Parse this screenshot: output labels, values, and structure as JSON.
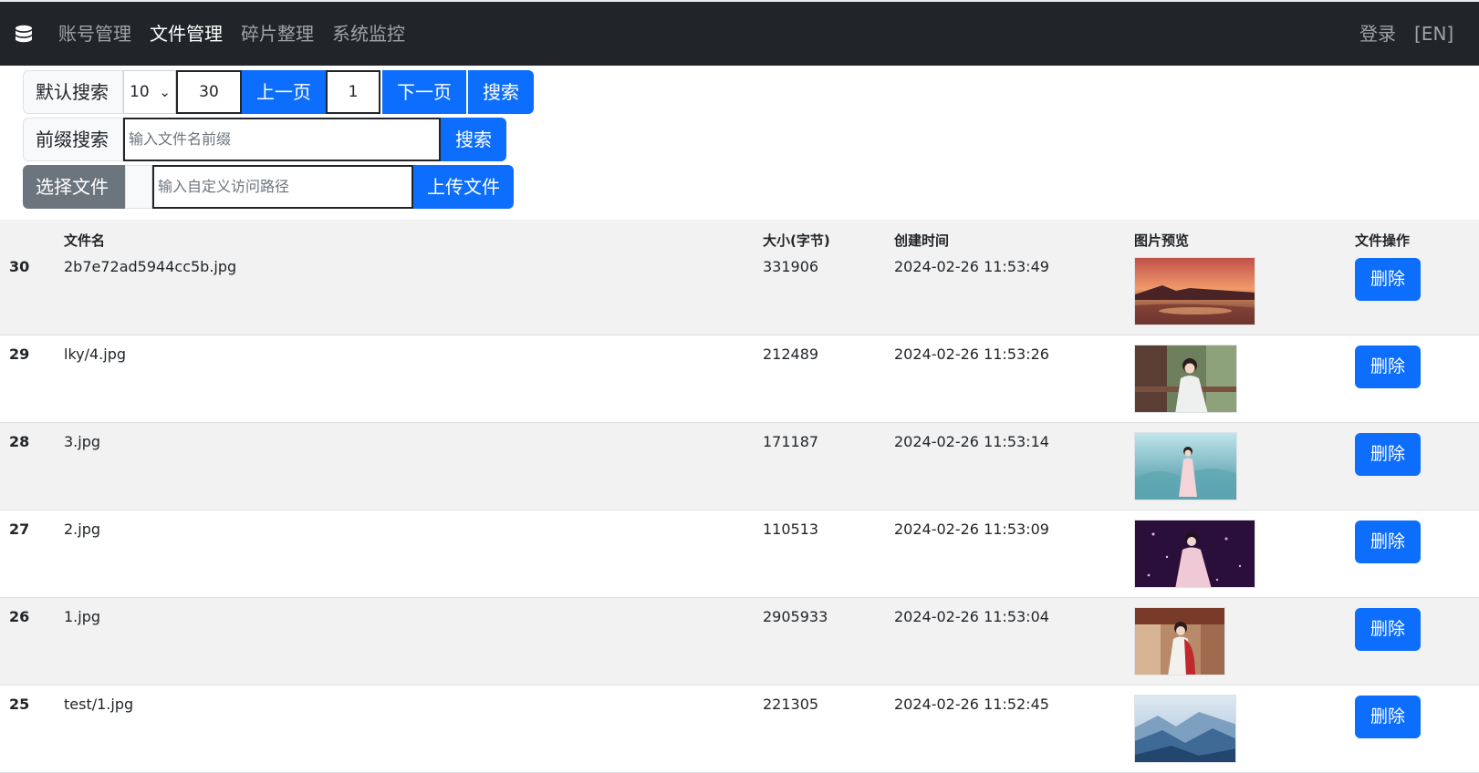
{
  "nav": {
    "items": [
      {
        "label": "账号管理",
        "active": false
      },
      {
        "label": "文件管理",
        "active": true
      },
      {
        "label": "碎片整理",
        "active": false
      },
      {
        "label": "系统监控",
        "active": false
      }
    ],
    "login_label": "登录",
    "lang_label": "[EN]"
  },
  "default_search": {
    "label": "默认搜索",
    "page_size": "10",
    "start_value": "30",
    "prev_label": "上一页",
    "page_value": "1",
    "next_label": "下一页",
    "search_label": "搜索"
  },
  "prefix_search": {
    "label": "前缀搜索",
    "placeholder": "输入文件名前缀",
    "search_label": "搜索"
  },
  "upload": {
    "choose_label": "选择文件",
    "path_placeholder": "输入自定义访问路径",
    "upload_label": "上传文件"
  },
  "table": {
    "headers": {
      "name": "文件名",
      "size": "大小(字节)",
      "time": "创建时间",
      "preview": "图片预览",
      "action": "文件操作"
    },
    "rows": [
      {
        "id": "30",
        "name": "2b7e72ad5944cc5b.jpg",
        "size": "331906",
        "time": "2024-02-26 11:53:49",
        "delete_label": "删除",
        "preview": "sunset-beach-image"
      },
      {
        "id": "29",
        "name": "lky/4.jpg",
        "size": "212489",
        "time": "2024-02-26 11:53:26",
        "delete_label": "删除",
        "preview": "woman-in-white-dress-image"
      },
      {
        "id": "28",
        "name": "3.jpg",
        "size": "171187",
        "time": "2024-02-26 11:53:14",
        "delete_label": "删除",
        "preview": "singer-misty-stage-image"
      },
      {
        "id": "27",
        "name": "2.jpg",
        "size": "110513",
        "time": "2024-02-26 11:53:09",
        "delete_label": "删除",
        "preview": "singer-purple-stage-image"
      },
      {
        "id": "26",
        "name": "1.jpg",
        "size": "2905933",
        "time": "2024-02-26 11:53:04",
        "delete_label": "删除",
        "preview": "woman-red-shawl-image"
      },
      {
        "id": "25",
        "name": "test/1.jpg",
        "size": "221305",
        "time": "2024-02-26 11:52:45",
        "delete_label": "删除",
        "preview": "mountain-valley-image"
      }
    ]
  },
  "colors": {
    "navbar": "#212529",
    "primary": "#0d6efd",
    "secondary": "#6c757d",
    "stripe": "#f2f2f2"
  }
}
